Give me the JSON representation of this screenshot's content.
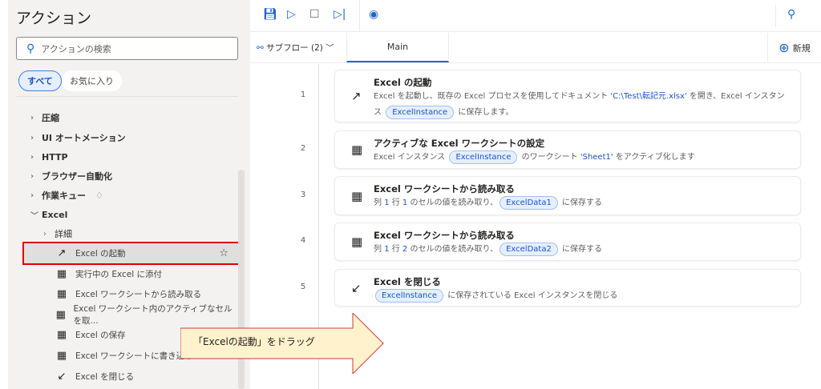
{
  "sidebar": {
    "title": "アクション",
    "search_placeholder": "アクションの検索",
    "chips": [
      "すべて",
      "お気に入り"
    ],
    "groups": [
      {
        "label": "圧縮"
      },
      {
        "label": "UI オートメーション"
      },
      {
        "label": "HTTP"
      },
      {
        "label": "ブラウザー自動化"
      },
      {
        "label": "作業キュー",
        "badge_icon": "diamond-icon"
      },
      {
        "label": "Excel",
        "expanded": true
      }
    ],
    "subgroup": "詳細",
    "actions": [
      {
        "label": "Excel の起動",
        "icon": "launch-arrow-icon",
        "selected": true
      },
      {
        "label": "実行中の Excel に添付",
        "icon": "excel-sheet-icon"
      },
      {
        "label": "Excel ワークシートから読み取る",
        "icon": "excel-sheet-icon"
      },
      {
        "label": "Excel ワークシート内のアクティブなセルを取...",
        "icon": "excel-sheet-icon"
      },
      {
        "label": "Excel の保存",
        "icon": "excel-sheet-icon"
      },
      {
        "label": "Excel ワークシートに書き込む",
        "icon": "excel-sheet-icon"
      },
      {
        "label": "Excel を閉じる",
        "icon": "close-arrow-icon"
      }
    ]
  },
  "tabs": {
    "subflow": "サブフロー (2)",
    "main": "Main",
    "new": "新規"
  },
  "steps": [
    {
      "num": "1",
      "title": "Excel の起動",
      "icon": "launch-arrow-icon",
      "desc": [
        [
          "t",
          "Excel を起動し、既存の Excel プロセスを使用してドキュメント "
        ],
        [
          "l",
          "'C:\\Test\\転記元.xlsx'"
        ],
        [
          "t",
          " を開き、Excel インスタンス "
        ],
        [
          "p",
          "ExcelInstance"
        ],
        [
          "t",
          " に保存します。"
        ]
      ]
    },
    {
      "num": "2",
      "title": "アクティブな Excel ワークシートの設定",
      "icon": "excel-sheet-icon",
      "desc": [
        [
          "t",
          "Excel インスタンス "
        ],
        [
          "p",
          "ExcelInstance"
        ],
        [
          "t",
          " のワークシート "
        ],
        [
          "l",
          "'Sheet1'"
        ],
        [
          "t",
          " をアクティブ化します"
        ]
      ]
    },
    {
      "num": "3",
      "title": "Excel ワークシートから読み取る",
      "icon": "excel-sheet-icon",
      "desc": [
        [
          "t",
          "列 "
        ],
        [
          "l",
          "1"
        ],
        [
          "t",
          " 行 "
        ],
        [
          "l",
          "1"
        ],
        [
          "t",
          " のセルの値を読み取り、"
        ],
        [
          "p",
          "ExcelData1"
        ],
        [
          "t",
          " に保存する"
        ]
      ]
    },
    {
      "num": "4",
      "title": "Excel ワークシートから読み取る",
      "icon": "excel-sheet-icon",
      "desc": [
        [
          "t",
          "列 "
        ],
        [
          "l",
          "1"
        ],
        [
          "t",
          " 行 "
        ],
        [
          "l",
          "2"
        ],
        [
          "t",
          " のセルの値を読み取り、"
        ],
        [
          "p",
          "ExcelData2"
        ],
        [
          "t",
          " に保存する"
        ]
      ]
    },
    {
      "num": "5",
      "title": "Excel を閉じる",
      "icon": "close-arrow-icon",
      "desc": [
        [
          "p",
          "ExcelInstance"
        ],
        [
          "t",
          " に保存されている Excel インスタンスを閉じる"
        ]
      ]
    }
  ],
  "callout": {
    "text": "「Excelの起動」をドラッグ",
    "fill": "#fff2cc",
    "border": "#d9363e"
  },
  "colors": {
    "accent": "#2266cc",
    "highlight": "#e00000"
  }
}
